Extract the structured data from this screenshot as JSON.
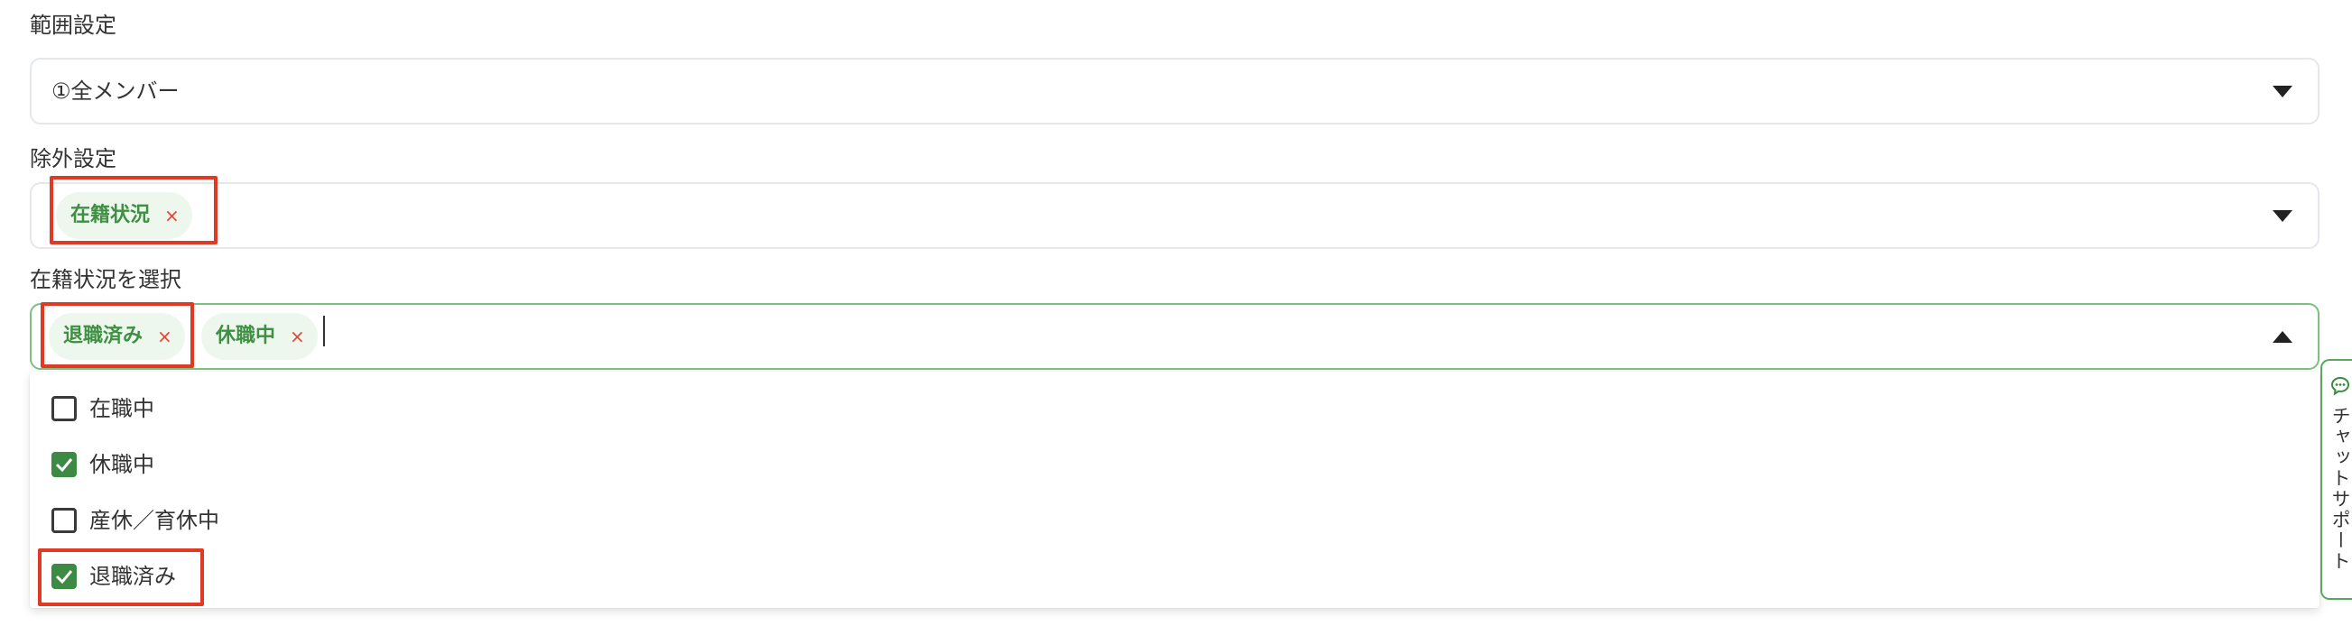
{
  "range": {
    "label": "範囲設定",
    "selected": "①全メンバー"
  },
  "exclusion": {
    "label": "除外設定",
    "chips": [
      {
        "label": "在籍状況",
        "remove": "×"
      }
    ]
  },
  "status_select": {
    "label": "在籍状況を選択",
    "chips": [
      {
        "label": "退職済み",
        "remove": "×"
      },
      {
        "label": "休職中",
        "remove": "×"
      }
    ],
    "options": [
      {
        "label": "在職中",
        "checked": false
      },
      {
        "label": "休職中",
        "checked": true
      },
      {
        "label": "産休／育休中",
        "checked": false
      },
      {
        "label": "退職済み",
        "checked": true
      }
    ]
  },
  "chat_support": {
    "label": "チャットサポート",
    "icon": "chat-bubble-icon"
  },
  "colors": {
    "accent": "#3c8a43",
    "chip_bg": "#eef7ee",
    "remove_x": "#e0473c",
    "highlight": "#e03a25"
  }
}
